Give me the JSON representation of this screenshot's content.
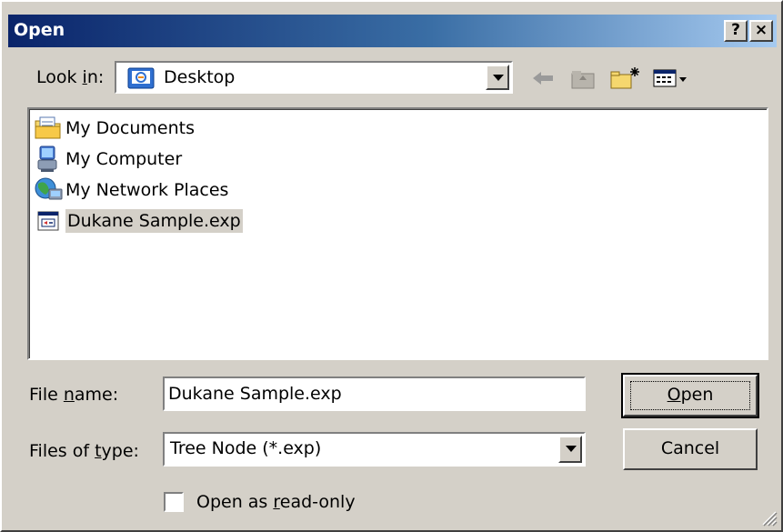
{
  "title_bar": {
    "title": "Open",
    "help_label": "?",
    "close_label": "×"
  },
  "look_in": {
    "label_pre": "Look ",
    "label_key": "i",
    "label_post": "n:",
    "value": "Desktop",
    "icon": "desktop-icon"
  },
  "toolbar": {
    "icons": [
      "back-arrow-icon",
      "up-folder-icon",
      "new-folder-icon",
      "views-menu-icon"
    ]
  },
  "file_list": {
    "items": [
      {
        "label": "My Documents",
        "icon": "my-documents-icon",
        "selected": false
      },
      {
        "label": "My Computer",
        "icon": "my-computer-icon",
        "selected": false
      },
      {
        "label": "My Network Places",
        "icon": "network-places-icon",
        "selected": false
      },
      {
        "label": "Dukane Sample.exp",
        "icon": "exp-file-icon",
        "selected": true
      }
    ]
  },
  "file_name": {
    "label_pre": "File ",
    "label_key": "n",
    "label_post": "ame:",
    "value": "Dukane Sample.exp"
  },
  "file_type": {
    "label_pre": "Files of ",
    "label_key": "t",
    "label_post": "ype:",
    "value": "Tree Node (*.exp)"
  },
  "buttons": {
    "open_key": "O",
    "open_rest": "pen",
    "cancel": "Cancel"
  },
  "read_only": {
    "label_pre": "Open as ",
    "label_key": "r",
    "label_post": "ead-only",
    "checked": false
  },
  "colors": {
    "title_gradient_start": "#0a246a",
    "title_gradient_end": "#a6caf0",
    "face": "#d4d0c8"
  }
}
